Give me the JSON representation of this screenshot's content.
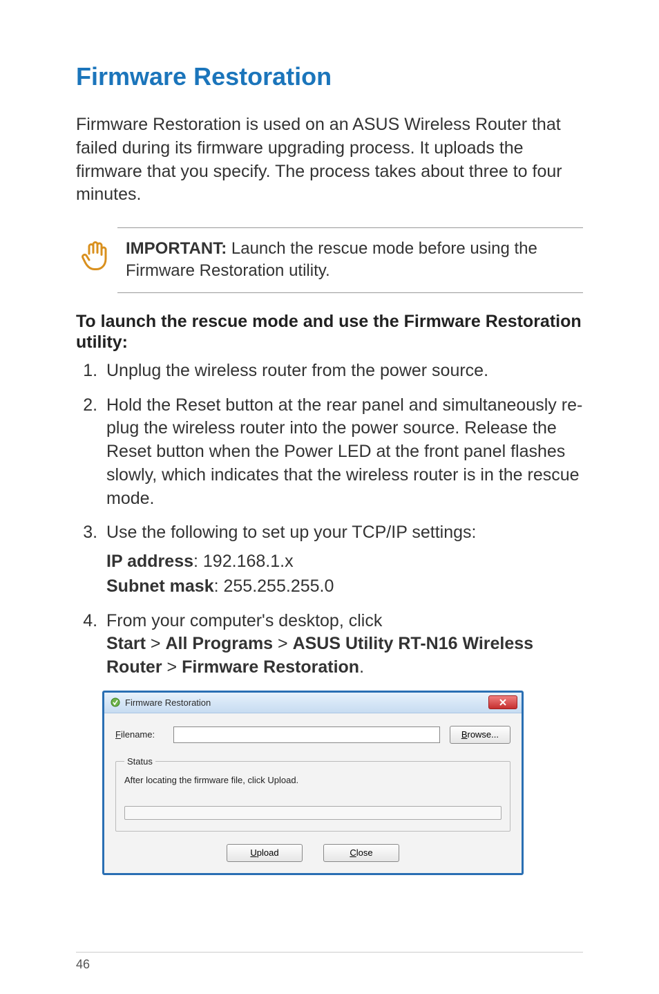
{
  "title": "Firmware Restoration",
  "intro": "Firmware Restoration is used on an ASUS Wireless Router that failed during its firmware upgrading process. It uploads the firmware that you specify. The process takes about three to four minutes.",
  "important": {
    "label": "IMPORTANT:",
    "text": " Launch the rescue mode before using the Firmware Restoration utility."
  },
  "subheading": "To launch the rescue mode and use the Firmware Restoration utility:",
  "steps": {
    "s1": "Unplug the wireless router from the power source.",
    "s2": "Hold the Reset button at the rear panel and simultaneously re-plug the wireless router into the power source. Release the Reset button when the Power LED at the front panel flashes slowly, which indicates that the wireless router is in the rescue mode.",
    "s3": "Use the following to set up your TCP/IP settings:",
    "s3_ip_label": "IP address",
    "s3_ip_value": ": 192.168.1.x",
    "s3_mask_label": "Subnet mask",
    "s3_mask_value": ": 255.255.255.0",
    "s4_pre": "From your computer's desktop, click",
    "s4_path1": "Start",
    "s4_sep": " > ",
    "s4_path2": "All Programs",
    "s4_path3": "ASUS Utility RT-N16 Wireless Router",
    "s4_path4": "Firmware Restoration",
    "s4_period": "."
  },
  "dialog": {
    "title": "Firmware Restoration",
    "filename_label": "Filename:",
    "filename_value": "",
    "browse": "Browse...",
    "status_legend": "Status",
    "status_text": "After locating the firmware file, click Upload.",
    "upload": "Upload",
    "close": "Close"
  },
  "page_number": "46"
}
